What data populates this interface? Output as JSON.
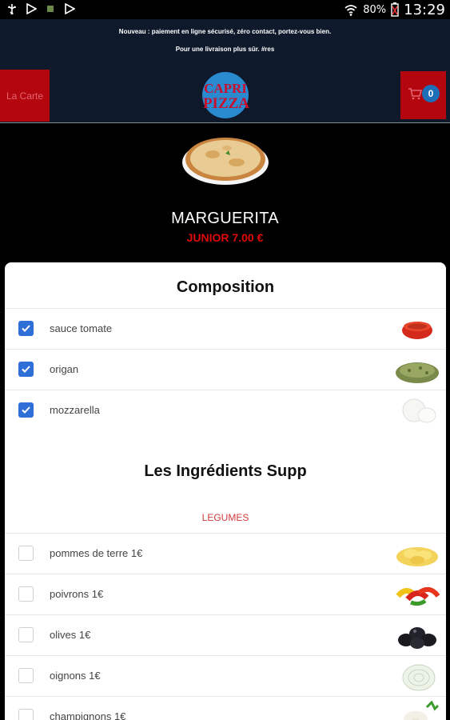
{
  "status_bar": {
    "battery": "80%",
    "time": "13:29"
  },
  "header": {
    "announcement_line1": "Nouveau : paiement en ligne sécurisé, zéro contact, portez-vous bien.",
    "announcement_line2": "Pour une livraison plus sûr. #res",
    "carte_button": "La Carte",
    "logo_text_1": "CAPRI",
    "logo_text_2": "PIZZA",
    "cart_count": "0"
  },
  "product": {
    "name": "MARGUERITA",
    "price": "JUNIOR 7.00 €"
  },
  "composition": {
    "title": "Composition",
    "items": [
      {
        "label": "sauce tomate",
        "checked": true,
        "icon": "tomato-sauce-icon"
      },
      {
        "label": "origan",
        "checked": true,
        "icon": "oregano-icon"
      },
      {
        "label": "mozzarella",
        "checked": true,
        "icon": "mozzarella-icon"
      }
    ]
  },
  "extras": {
    "title": "Les Ingrédients Supp",
    "category": "LEGUMES",
    "items": [
      {
        "label": "pommes de terre 1€",
        "checked": false,
        "icon": "potato-icon"
      },
      {
        "label": "poivrons 1€",
        "checked": false,
        "icon": "pepper-icon"
      },
      {
        "label": "olives 1€",
        "checked": false,
        "icon": "olive-icon"
      },
      {
        "label": "oignons 1€",
        "checked": false,
        "icon": "onion-icon"
      },
      {
        "label": "champignons 1€",
        "checked": false,
        "icon": "mushroom-icon"
      }
    ]
  },
  "colors": {
    "header_bg": "#0e1a2c",
    "accent_red": "#b3060e",
    "price_red": "#e10a0a",
    "checkbox_blue": "#2f6fd8",
    "badge_blue": "#1f6fb8"
  }
}
